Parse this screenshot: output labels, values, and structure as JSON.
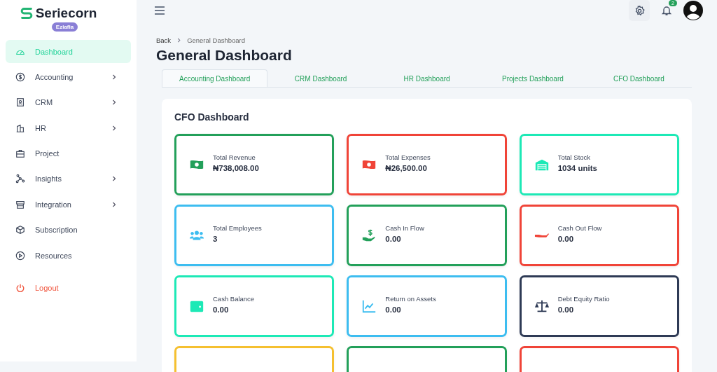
{
  "brand": {
    "name": "Seriecorn",
    "badge": "Eziafia"
  },
  "sidebar": {
    "items": [
      {
        "label": "Dashboard",
        "kind": "gauge",
        "selected": true,
        "has_submenu": false
      },
      {
        "label": "Accounting",
        "kind": "dollar",
        "selected": false,
        "has_submenu": true
      },
      {
        "label": "CRM",
        "kind": "contact",
        "selected": false,
        "has_submenu": true
      },
      {
        "label": "HR",
        "kind": "building",
        "selected": false,
        "has_submenu": true
      },
      {
        "label": "Project",
        "kind": "briefcase",
        "selected": false,
        "has_submenu": false
      },
      {
        "label": "Insights",
        "kind": "nodes",
        "selected": false,
        "has_submenu": true
      },
      {
        "label": "Integration",
        "kind": "store",
        "selected": false,
        "has_submenu": true
      },
      {
        "label": "Subscription",
        "kind": "box",
        "selected": false,
        "has_submenu": false
      },
      {
        "label": "Resources",
        "kind": "play",
        "selected": false,
        "has_submenu": false
      }
    ],
    "logout": "Logout"
  },
  "header": {
    "notifications": "2"
  },
  "breadcrumb": {
    "back": "Back",
    "current": "General Dashboard"
  },
  "title": "General Dashboard",
  "tabs": [
    {
      "label": "Accounting Dashboard",
      "selected": true
    },
    {
      "label": "CRM Dashboard",
      "selected": false
    },
    {
      "label": "HR Dashboard",
      "selected": false
    },
    {
      "label": "Projects Dashboard",
      "selected": false
    },
    {
      "label": "CFO Dashboard",
      "selected": false
    }
  ],
  "panel": {
    "title": "CFO Dashboard",
    "cards": [
      {
        "label": "Total Revenue",
        "value": "₦738,008.00",
        "kind": "cash",
        "color": "#23a05a"
      },
      {
        "label": "Total Expenses",
        "value": "₦26,500.00",
        "kind": "cash",
        "color": "#f04438"
      },
      {
        "label": "Total Stock",
        "value": "1034 units",
        "kind": "warehouse",
        "color": "#1de9b6"
      },
      {
        "label": "Total Employees",
        "value": "3",
        "kind": "people",
        "color": "#3dbdf0"
      },
      {
        "label": "Cash In Flow",
        "value": "0.00",
        "kind": "hand-dollar",
        "color": "#23a05a"
      },
      {
        "label": "Cash Out Flow",
        "value": "0.00",
        "kind": "hand",
        "color": "#f04438"
      },
      {
        "label": "Cash Balance",
        "value": "0.00",
        "kind": "wallet",
        "color": "#1de9b6"
      },
      {
        "label": "Return on Assets",
        "value": "0.00",
        "kind": "chart",
        "color": "#3dbdf0"
      },
      {
        "label": "Debt Equity Ratio",
        "value": "0.00",
        "kind": "scale",
        "color": "#2e3a55"
      },
      {
        "kind": "partial",
        "color": "#f5c030"
      },
      {
        "kind": "partial",
        "color": "#23a05a"
      },
      {
        "kind": "partial",
        "color": "#f04438"
      }
    ]
  }
}
